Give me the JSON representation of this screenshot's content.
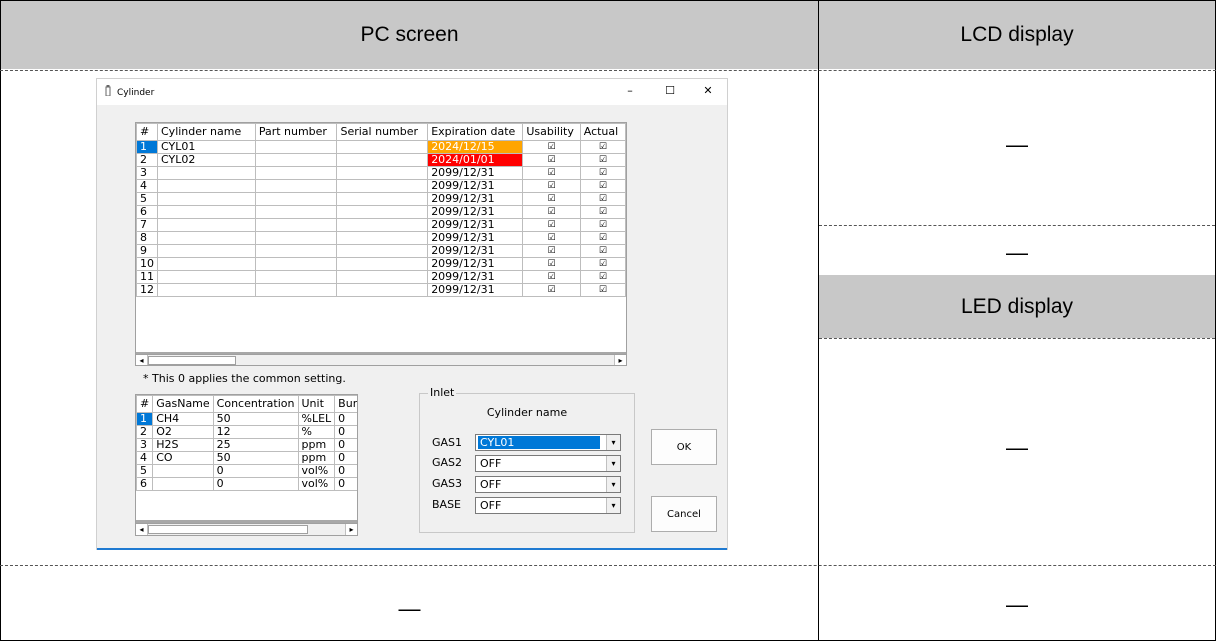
{
  "doc": {
    "pc_header": "PC screen",
    "lcd_header": "LCD display",
    "led_header": "LED display",
    "lcd_cell_1": "—",
    "lcd_cell_2": "—",
    "led_cell": "—",
    "bottom_left": "—",
    "bottom_right": "—"
  },
  "window": {
    "title": "Cylinder",
    "minimize": "–",
    "maximize": "☐",
    "close": "✕"
  },
  "cylinder_table": {
    "headers": [
      "#",
      "Cylinder name",
      "Part number",
      "Serial number",
      "Expiration date",
      "Usability",
      "Actual"
    ],
    "rows": [
      {
        "num": "1",
        "name": "CYL01",
        "part": "",
        "serial": "",
        "exp": "2024/12/15",
        "use": "☑",
        "act": "☑"
      },
      {
        "num": "2",
        "name": "CYL02",
        "part": "",
        "serial": "",
        "exp": "2024/01/01",
        "use": "☑",
        "act": "☑"
      },
      {
        "num": "3",
        "name": "",
        "part": "",
        "serial": "",
        "exp": "2099/12/31",
        "use": "☑",
        "act": "☑"
      },
      {
        "num": "4",
        "name": "",
        "part": "",
        "serial": "",
        "exp": "2099/12/31",
        "use": "☑",
        "act": "☑"
      },
      {
        "num": "5",
        "name": "",
        "part": "",
        "serial": "",
        "exp": "2099/12/31",
        "use": "☑",
        "act": "☑"
      },
      {
        "num": "6",
        "name": "",
        "part": "",
        "serial": "",
        "exp": "2099/12/31",
        "use": "☑",
        "act": "☑"
      },
      {
        "num": "7",
        "name": "",
        "part": "",
        "serial": "",
        "exp": "2099/12/31",
        "use": "☑",
        "act": "☑"
      },
      {
        "num": "8",
        "name": "",
        "part": "",
        "serial": "",
        "exp": "2099/12/31",
        "use": "☑",
        "act": "☑"
      },
      {
        "num": "9",
        "name": "",
        "part": "",
        "serial": "",
        "exp": "2099/12/31",
        "use": "☑",
        "act": "☑"
      },
      {
        "num": "10",
        "name": "",
        "part": "",
        "serial": "",
        "exp": "2099/12/31",
        "use": "☑",
        "act": "☑"
      },
      {
        "num": "11",
        "name": "",
        "part": "",
        "serial": "",
        "exp": "2099/12/31",
        "use": "☑",
        "act": "☑"
      },
      {
        "num": "12",
        "name": "",
        "part": "",
        "serial": "",
        "exp": "2099/12/31",
        "use": "☑",
        "act": "☑"
      }
    ]
  },
  "note": "* This 0 applies the common setting.",
  "gas_table": {
    "headers": [
      "#",
      "GasName",
      "Concentration",
      "Unit",
      "BumpAll"
    ],
    "rows": [
      {
        "num": "1",
        "name": "CH4",
        "conc": "50",
        "unit": "%LEL",
        "bump": "0"
      },
      {
        "num": "2",
        "name": "O2",
        "conc": "12",
        "unit": "%",
        "bump": "0"
      },
      {
        "num": "3",
        "name": "H2S",
        "conc": "25",
        "unit": "ppm",
        "bump": "0"
      },
      {
        "num": "4",
        "name": "CO",
        "conc": "50",
        "unit": "ppm",
        "bump": "0"
      },
      {
        "num": "5",
        "name": "",
        "conc": "0",
        "unit": "vol%",
        "bump": "0"
      },
      {
        "num": "6",
        "name": "",
        "conc": "0",
        "unit": "vol%",
        "bump": "0"
      }
    ]
  },
  "inlet": {
    "legend": "Inlet",
    "column_title": "Cylinder name",
    "gas1_label": "GAS1",
    "gas1_value": "CYL01",
    "gas2_label": "GAS2",
    "gas2_value": "OFF",
    "gas3_label": "GAS3",
    "gas3_value": "OFF",
    "base_label": "BASE",
    "base_value": "OFF"
  },
  "buttons": {
    "ok": "OK",
    "cancel": "Cancel"
  },
  "colors": {
    "warn": "#ffa500",
    "error": "#ff0000",
    "select": "#0078d7"
  }
}
